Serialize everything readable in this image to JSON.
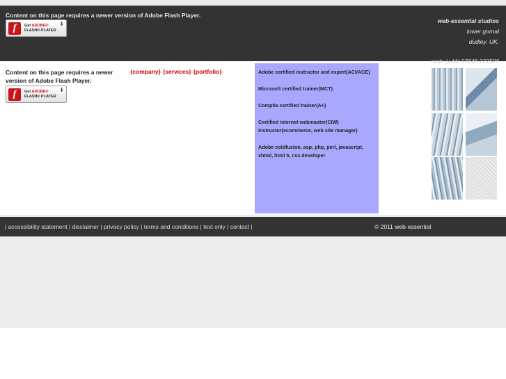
{
  "flash_notice": {
    "message": "Content on this page requires a newer version of Adobe Flash Player.",
    "badge_get": "Get",
    "badge_adobe": "ADOBE®",
    "badge_product": "FLASH® PLAYER"
  },
  "studio": {
    "name": "web-essential studios",
    "address_line1": "lower gornal",
    "address_line2": "dudley. UK.",
    "mobile": "mob: (+44) 07846 222526"
  },
  "nav": {
    "items": [
      "{company}",
      "{services}",
      "{portfolio}"
    ]
  },
  "credentials": [
    "Adobe certified instructor and expert(ACI/ACE)",
    "Microsoft certified trainer(MCT)",
    "Comptia certified trainer(A+)",
    "Certified internet webmaster(CIW) instructor(ecommerce, web site manager)",
    "Adobe coldfusion, asp, php, perl, javascript, xhtml, html 5, css developer"
  ],
  "footer": {
    "links": [
      "accessibility statement",
      "disclaimer",
      "privacy policy",
      "terms and conditions",
      "text only",
      "contact"
    ],
    "copyright": "© 2011 web-essential"
  },
  "colors": {
    "header_bg": "#333333",
    "credentials_bg": "#a8a8ff",
    "nav_link": "#cc0000",
    "page_gray": "#ececec"
  },
  "icons": [
    "flash-player-logo-icon",
    "download-arrow-icon"
  ]
}
